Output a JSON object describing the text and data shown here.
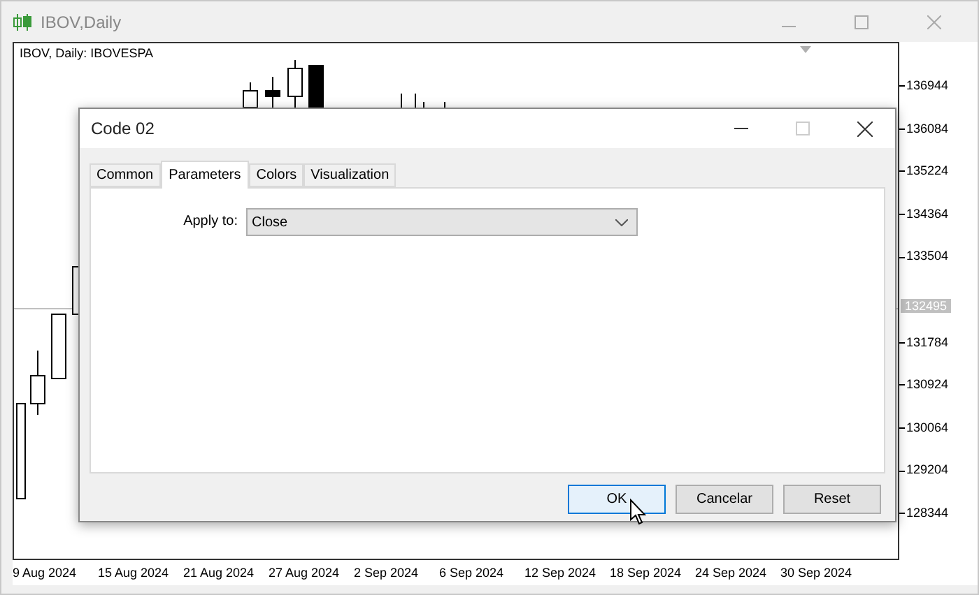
{
  "window": {
    "title": "IBOV,Daily"
  },
  "chart": {
    "label": "IBOV, Daily:  IBOVESPA",
    "price_labels": [
      "136944",
      "136084",
      "135224",
      "134364",
      "133504",
      "131784",
      "130924",
      "130064",
      "129204",
      "128344"
    ],
    "current_price": "132495",
    "date_labels": [
      "9 Aug 2024",
      "15 Aug 2024",
      "21 Aug 2024",
      "27 Aug 2024",
      "2 Sep 2024",
      "6 Sep 2024",
      "12 Sep 2024",
      "18 Sep 2024",
      "24 Sep 2024",
      "30 Sep 2024"
    ]
  },
  "dialog": {
    "title": "Code 02",
    "tabs": [
      {
        "label": "Common",
        "selected": false
      },
      {
        "label": "Parameters",
        "selected": true
      },
      {
        "label": "Colors",
        "selected": false
      },
      {
        "label": "Visualization",
        "selected": false
      }
    ],
    "apply_to": {
      "label": "Apply to:",
      "value": "Close"
    },
    "buttons": [
      {
        "label": "OK",
        "focused": true
      },
      {
        "label": "Cancelar",
        "focused": false
      },
      {
        "label": "Reset",
        "focused": false
      }
    ]
  }
}
